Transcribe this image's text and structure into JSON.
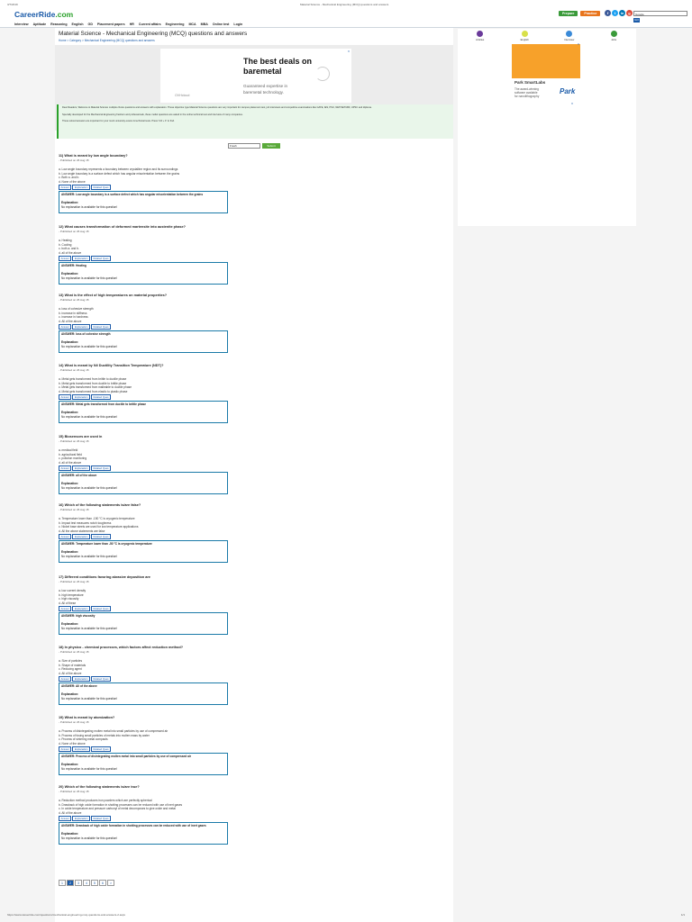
{
  "print_header": {
    "date": "3/7/2019",
    "title": "Material Science - Mechanical Engineering (MCQ) questions and answers"
  },
  "print_footer": {
    "url": "https://www.careerride.com/questions/mechanical-engineering-mcq-questions-and-answers-2.aspx",
    "page": "1/1"
  },
  "header": {
    "logo_main": "CareerRide",
    "logo_suffix": ".com",
    "prepare_label": "Prepare",
    "practice_label": "Practice",
    "search_value": "Google",
    "search_go": "GO",
    "social": [
      "f",
      "t",
      "in",
      "g"
    ]
  },
  "nav": [
    "Interview",
    "Aptitude",
    "Reasoning",
    "English",
    "GD",
    "Placement papers",
    "HR",
    "Current affairs",
    "Engineering",
    "MCA",
    "MBA",
    "Online test",
    "Login"
  ],
  "page": {
    "title": "Material Science - Mechanical Engineering (MCQ) questions and answers",
    "breadcrumb": "Home > Category > Mechanical Engineering (MCQ) questions and answers"
  },
  "ad": {
    "title_line1": "The best deals on",
    "title_line2": "baremetal",
    "sub_line1": "Guaranteed expertise in",
    "sub_line2": "baremetal technology.",
    "brand": "OVHcloud",
    "close": "X"
  },
  "intro": [
    "Dear Readers, Welcome to Material Science multiple choice questions and answers with explanation. These objective type Material Science questions are very important for campus placement test, job interviews and competitive examinations like GATE, IES, PSU, NET/SET/JRF, UPSC and diploma.",
    "Specially developed for the Mechanical Engineering freshers and professionals, these model questions are asked in the online technical test and interview of many companies.",
    "These solved answers are important for your mock university exams & technical tests. Press 'Ctrl + F' to find."
  ],
  "toolbar": {
    "select_value": "Fresh",
    "submit_label": "Submit"
  },
  "tabs": [
    "Answer",
    "Explanation",
    "Related Ques"
  ],
  "explanation_label": "Explanation:",
  "no_explanation": "No explanation is available for this question!",
  "questions": [
    {
      "num": "11)",
      "title": "What is meant by low angle boundary?",
      "pub": "- Published on 26 Aug 15",
      "options": [
        "a. Low angle boundary represents a boundary between crystalline region and its surroundings",
        "b. Low angle boundary is a surface defect which has angular misorientation between the grains",
        "c. Both a. and b.",
        "d. None of the above"
      ],
      "answer": "ANSWER: Low angle boundary is a surface defect which has angular misorientation between the grains"
    },
    {
      "num": "12)",
      "title": "What causes transformation of deformed martensite into austenite phase?",
      "pub": "- Published on 26 Aug 15",
      "options": [
        "a. Heating",
        "b. Cooling",
        "c. both a. and b.",
        "d. all of the above"
      ],
      "answer": "ANSWER: Heating"
    },
    {
      "num": "13)",
      "title": "What is the effect of high temperatures on material properties?",
      "pub": "- Published on 26 Aug 15",
      "options": [
        "a. loss of cohesive strength",
        "b. increase in stiffness",
        "c. increase in hardness",
        "d. All of the above"
      ],
      "answer": "ANSWER: loss of cohesive strength"
    },
    {
      "num": "14)",
      "title": "What is meant by Nil Ductility Transition Temperature (NDT)?",
      "pub": "- Published on 26 Aug 15",
      "options": [
        "a. Metal gets transformed from brittle to ductile phase",
        "b. Metal gets transformed from ductile to brittle phase",
        "c. Metal gets transformed from malleable to ductile phase",
        "d. Metal gets transformed from elastic to plastic phase"
      ],
      "answer": "ANSWER: Metal gets transformed from ductile to brittle phase"
    },
    {
      "num": "15)",
      "title": "Biosensors are used in",
      "pub": "- Published on 26 Aug 15",
      "options": [
        "a. medical field",
        "b. agricultural field",
        "c. pollution monitoring",
        "d. all of the above"
      ],
      "answer": "ANSWER: all of the above"
    },
    {
      "num": "16)",
      "title": "Which of the following statements is/are false?",
      "pub": "- Published on 26 Aug 15",
      "options": [
        "a. Temperature lower than -150 °C is cryogenic temperature",
        "b. Impact test measures notch toughness",
        "c. Nickel base steels are used for low temperature applications",
        "d. All the above statements are false"
      ],
      "answer": "ANSWER: Temperature lower than -50 °C is cryogenic temperature"
    },
    {
      "num": "17)",
      "title": "Different conditions favoring abrasive deposition are",
      "pub": "- Published on 26 Aug 15",
      "options": [
        "a. low current density",
        "b. high temperature",
        "c. high viscosity",
        "d. All of these"
      ],
      "answer": "ANSWER: high viscosity"
    },
    {
      "num": "18)",
      "title": "In physico - chemical processes, which factors affect reduction method?",
      "pub": "- Published on 26 Aug 15",
      "options": [
        "a. Size of particles",
        "b. Shape of materials",
        "c. Reducing agent",
        "d. All of the above"
      ],
      "answer": "ANSWER: All of the above"
    },
    {
      "num": "19)",
      "title": "What is meant by atomization?",
      "pub": "- Published on 26 Aug 15",
      "options": [
        "a. Process of disintegrating molten metal into small particles by use of compressed air",
        "b. Process of fusing small particles of metals into molten mass by water",
        "c. Process of sintering metal compacts",
        "d. None of the above"
      ],
      "answer": "ANSWER: Process of disintegrating molten metal into small particles by use of compressed air"
    },
    {
      "num": "20)",
      "title": "Which of the following statements is/are true?",
      "pub": "- Published on 26 Aug 15",
      "options": [
        "a. Reduction method produces iron powders which are perfectly spherical",
        "b. Drawback of high oxide formation in shotting processes can be reduced with use of inert gases",
        "c. In oxide temperature and pressure carbonyl of metal decomposes to give oxide and metal",
        "d. All of the above"
      ],
      "answer": "ANSWER: Drawback of high oxide formation in shotting processes can be reduced with use of inert gases"
    }
  ],
  "pager": [
    "1",
    "2",
    "3",
    "4",
    "5",
    "6",
    ">"
  ],
  "sidebar": {
    "icons": [
      {
        "label": "Articles",
        "color": "#6a3a9a"
      },
      {
        "label": "English",
        "color": "#d8e04a"
      },
      {
        "label": "Interview",
        "color": "#3a8ad8"
      },
      {
        "label": "Jobs",
        "color": "#3a9a3a"
      }
    ],
    "ad_title": "Park SmartLabs",
    "ad_sub1": "The award-winning",
    "ad_sub2": "software available",
    "ad_sub3": "for nanolithography",
    "ad_brand": "Park",
    "ad_close": "X"
  }
}
